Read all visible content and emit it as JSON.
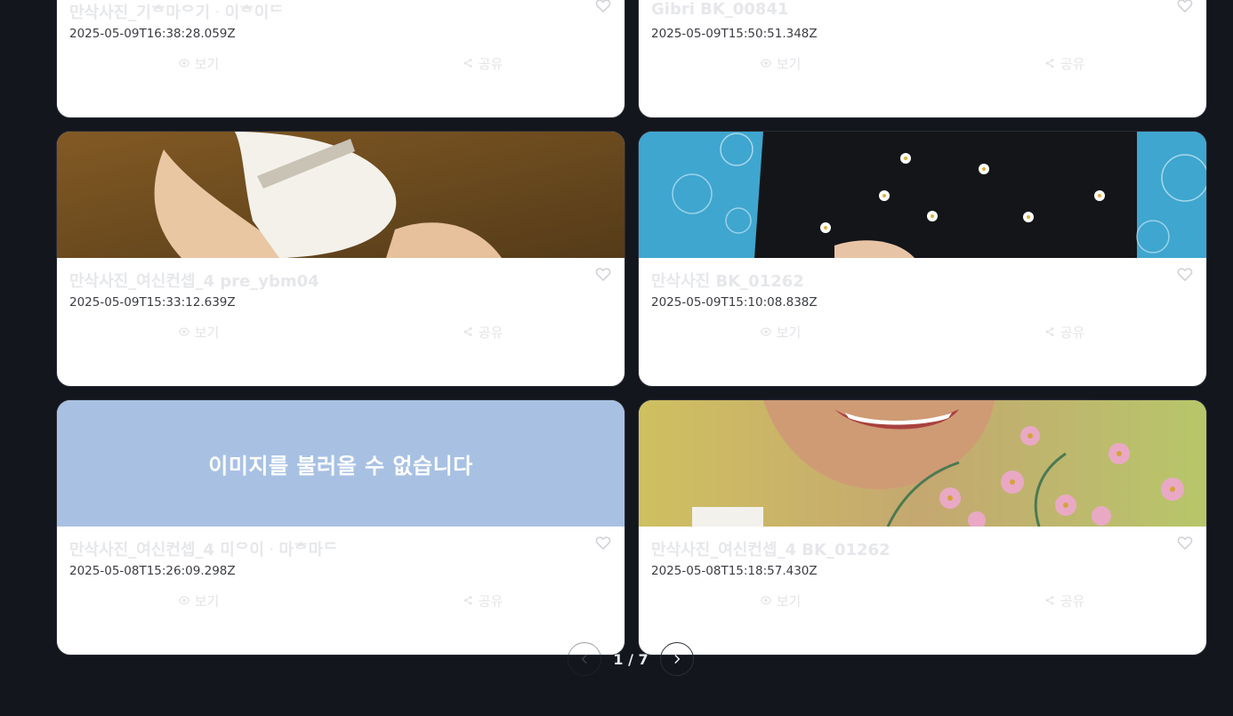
{
  "cards": [
    {
      "title": "만삭사진_기ᄒ마ᄋ기ᆞ이ᄒ이ᄃ",
      "date": "2025-05-09T16:38:28.059Z",
      "image": "photo-woman-black-daisy-sweater-bubbles",
      "thumb_text": ""
    },
    {
      "title": "Gibri BK_00841",
      "date": "2025-05-09T15:50:51.348Z",
      "image": "illustration-warm-tones",
      "thumb_text": ""
    },
    {
      "title": "만삭사진_여신컨셉_4 pre_ybm04",
      "date": "2025-05-09T15:33:12.639Z",
      "image": "photo-pregnant-woman-white-dress-grass",
      "thumb_text": ""
    },
    {
      "title": "만삭사진 BK_01262",
      "date": "2025-05-09T15:10:08.838Z",
      "image": "photo-black-daisy-sweater-bubbles",
      "thumb_text": ""
    },
    {
      "title": "만삭사진_여신컨셉_4 미ᄋ이ᆞ마ᄒ마ᄃ",
      "date": "2025-05-08T15:26:09.298Z",
      "image": "placeholder",
      "thumb_text": "이미지를 불러올 수 없습니다"
    },
    {
      "title": "만삭사진_여신컨셉_4 BK_01262",
      "date": "2025-05-08T15:18:57.430Z",
      "image": "photo-smiling-woman-pink-flowers",
      "thumb_text": ""
    }
  ],
  "actions": {
    "view_label": "보기",
    "share_label": "공유"
  },
  "pagination": {
    "text": "1 / 7",
    "current": 1,
    "total": 7
  },
  "colors": {
    "background": "#14161d",
    "card": "#ffffff",
    "placeholder": "#a8c1e3",
    "bubbles_bg": "#3fa6cf"
  }
}
